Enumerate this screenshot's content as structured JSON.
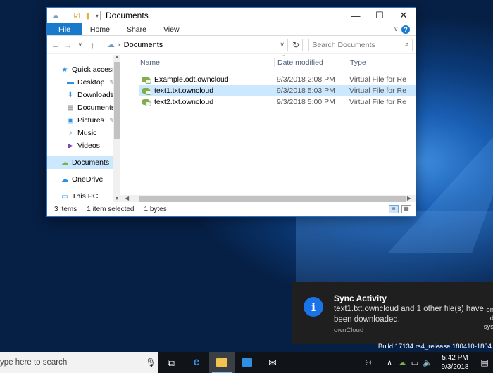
{
  "window": {
    "title": "Documents",
    "controls": {
      "minimize": "—",
      "maximize": "☐",
      "close": "✕"
    }
  },
  "ribbon": {
    "tabs": [
      "File",
      "Home",
      "Share",
      "View"
    ],
    "collapse": "∨",
    "help": "?"
  },
  "address": {
    "path": "Documents",
    "search_placeholder": "Search Documents"
  },
  "nav": {
    "items": [
      {
        "label": "Quick access",
        "icon": "star-icon",
        "glyph": "★",
        "pinned": false
      },
      {
        "label": "Desktop",
        "icon": "desktop-icon",
        "glyph": "▬",
        "pinned": true
      },
      {
        "label": "Downloads",
        "icon": "downloads-icon",
        "glyph": "⬇",
        "pinned": true
      },
      {
        "label": "Documents",
        "icon": "documents-icon",
        "glyph": "▤",
        "pinned": true
      },
      {
        "label": "Pictures",
        "icon": "pictures-icon",
        "glyph": "▣",
        "pinned": true
      },
      {
        "label": "Music",
        "icon": "music-icon",
        "glyph": "♪",
        "pinned": false
      },
      {
        "label": "Videos",
        "icon": "videos-icon",
        "glyph": "▶",
        "pinned": false
      },
      {
        "label": "Documents",
        "icon": "owncloud-icon",
        "glyph": "☁",
        "pinned": false,
        "selected": true
      },
      {
        "label": "OneDrive",
        "icon": "onedrive-icon",
        "glyph": "☁",
        "pinned": false
      },
      {
        "label": "This PC",
        "icon": "computer-icon",
        "glyph": "▭",
        "pinned": false
      }
    ]
  },
  "columns": {
    "name": "Name",
    "date": "Date modified",
    "type": "Type"
  },
  "files": [
    {
      "name": "Example.odt.owncloud",
      "date": "9/3/2018 2:08 PM",
      "type": "Virtual File for Re",
      "selected": false
    },
    {
      "name": "text1.txt.owncloud",
      "date": "9/3/2018 5:03 PM",
      "type": "Virtual File for Re",
      "selected": true
    },
    {
      "name": "text2.txt.owncloud",
      "date": "9/3/2018 5:00 PM",
      "type": "Virtual File for Re",
      "selected": false
    }
  ],
  "status": {
    "count": "3 items",
    "selected": "1 item selected",
    "size": "1 bytes"
  },
  "toast": {
    "title": "Sync Activity",
    "body": "text1.txt.owncloud and 1 other file(s) have been downloaded.",
    "source": "ownCloud",
    "icon_glyph": "i",
    "edge_text": "on\nd\nsys"
  },
  "build": "Build 17134.rs4_release.180410-1804",
  "taskbar": {
    "search_placeholder": "ype here to search",
    "time": "5:42 PM",
    "date": "9/3/2018"
  },
  "colors": {
    "accent": "#1979ca",
    "selection": "#cce8ff",
    "toast_bg": "#1f1f1f"
  }
}
